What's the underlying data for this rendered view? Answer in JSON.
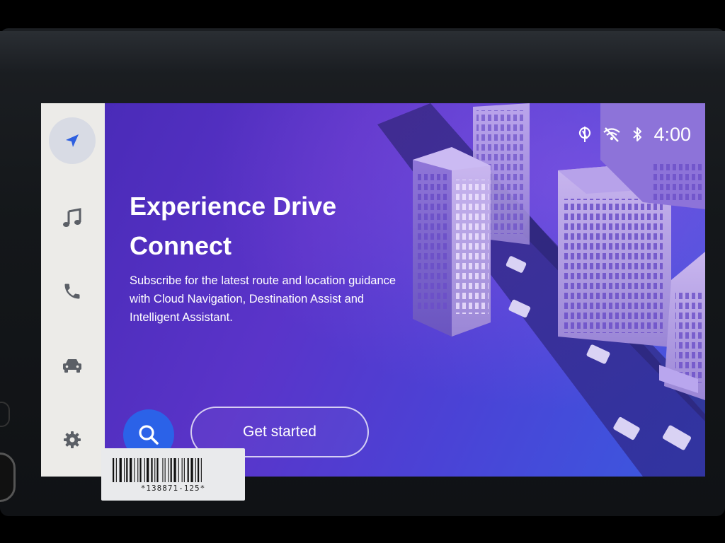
{
  "sidebar": {
    "items": [
      {
        "name": "navigation",
        "icon": "navigation-arrow-icon",
        "active": true
      },
      {
        "name": "music",
        "icon": "music-note-icon"
      },
      {
        "name": "phone",
        "icon": "phone-icon"
      },
      {
        "name": "vehicle",
        "icon": "car-icon"
      },
      {
        "name": "settings",
        "icon": "gear-icon"
      }
    ]
  },
  "status_bar": {
    "icons": [
      "signal-icon",
      "no-wifi-icon",
      "bluetooth-icon"
    ],
    "time": "4:00"
  },
  "promo": {
    "title": "Experience Drive Connect",
    "subtitle": "Subscribe for the latest route and location guidance with Cloud Navigation, Destination Assist and Intelligent Assistant.",
    "search_icon": "search-icon",
    "cta_label": "Get started"
  },
  "sticker": {
    "code": "*138871-125*"
  },
  "colors": {
    "accent_blue": "#2b62e8",
    "sidebar_bg": "#ecebe8",
    "background_purple": "#5a34c9"
  }
}
